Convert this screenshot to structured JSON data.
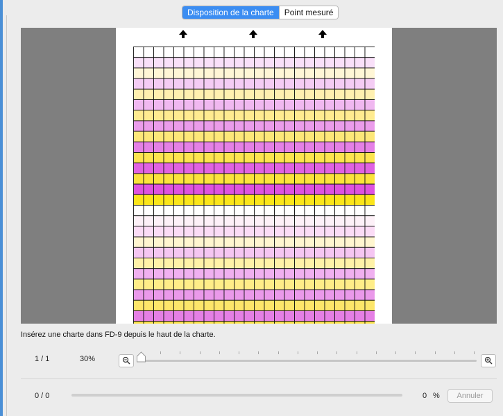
{
  "tabs": {
    "layout_label": "Disposition de la charte",
    "measured_label": "Point mesuré",
    "active": "layout"
  },
  "chart_preview": {
    "columns": 24,
    "visible_rows": 27,
    "patch_colors": [
      "#ffffff",
      "#f9e0f9",
      "#fff6d6",
      "#f4ccf4",
      "#fff0b0",
      "#f0b8f0",
      "#ffeb90",
      "#eb9ceb",
      "#fde779",
      "#e580e6",
      "#fde44f",
      "#e062e2",
      "#fbe33b",
      "#de52e0",
      "#fbe51a",
      "#ffffff",
      "#fdf1f8",
      "#fbdcf6",
      "#fff6d0",
      "#f5c6f2",
      "#fff2a8",
      "#f0b0f0",
      "#ffed88",
      "#ea99ea",
      "#fde66a",
      "#e57fe5",
      "#fde44c"
    ],
    "colors": {
      "background": "#7f7f7f",
      "paper": "#ffffff",
      "grid_line": "#111111",
      "arrow": "#000000"
    }
  },
  "status_message": "Insérez une charte dans FD-9 depuis le haut de la charte.",
  "zoom": {
    "page_indicator": "1 / 1",
    "level_label": "30%",
    "level_fraction": 0.0,
    "zoom_out_icon": "zoom-out-icon",
    "zoom_in_icon": "zoom-in-icon"
  },
  "progress": {
    "count": "0 / 0",
    "value": "0",
    "unit": "%",
    "fraction": 0.0,
    "cancel_label": "Annuler"
  },
  "colors": {
    "accent": "#3b8df2",
    "left_accent": "#4a8fd6"
  }
}
